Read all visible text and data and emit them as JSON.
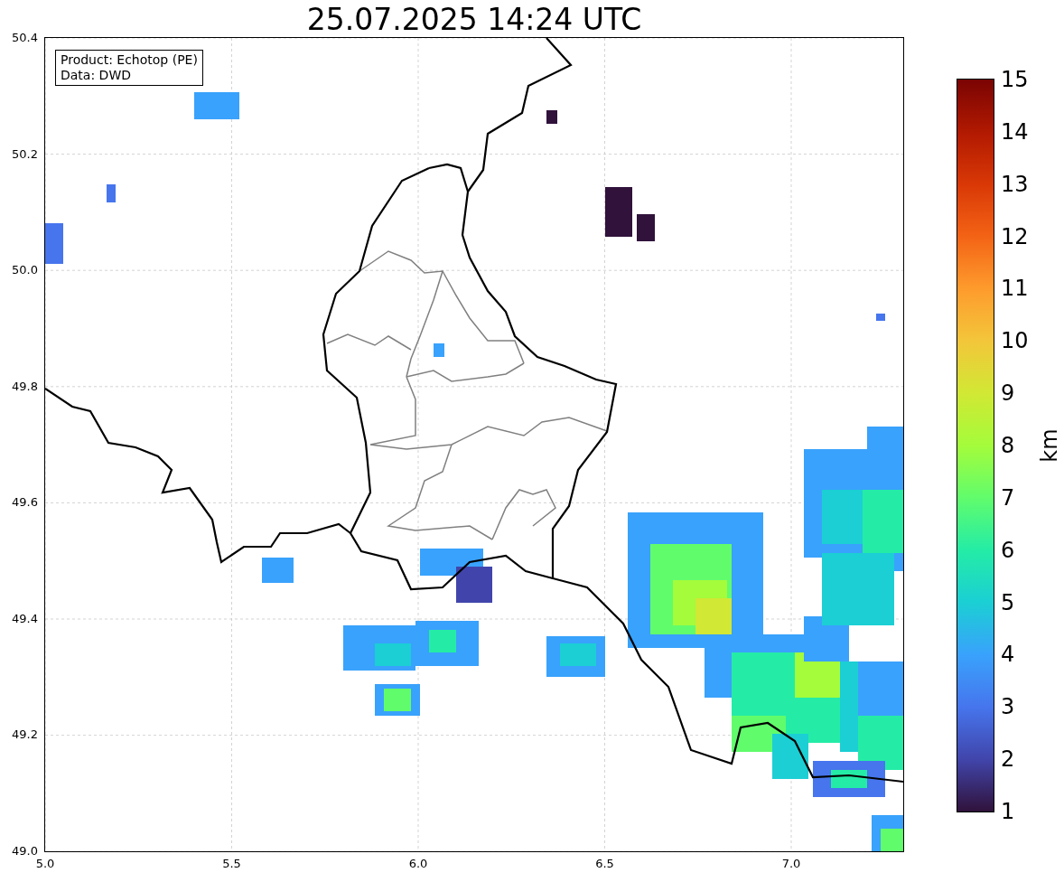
{
  "title": "25.07.2025 14:24 UTC",
  "legend": [
    "Product: Echotop (PE)",
    "Data: DWD"
  ],
  "y_ticks": [
    "50.4",
    "50.2",
    "50.0",
    "49.8",
    "49.6",
    "49.4",
    "49.2",
    "49.0"
  ],
  "x_ticks": [
    "5.0",
    "5.5",
    "6.0",
    "6.5",
    "7.0"
  ],
  "colorbar": {
    "label": "km",
    "ticks": [
      "15",
      "14",
      "13",
      "12",
      "11",
      "10",
      "9",
      "8",
      "7",
      "6",
      "5",
      "4",
      "3",
      "2",
      "1"
    ]
  }
}
